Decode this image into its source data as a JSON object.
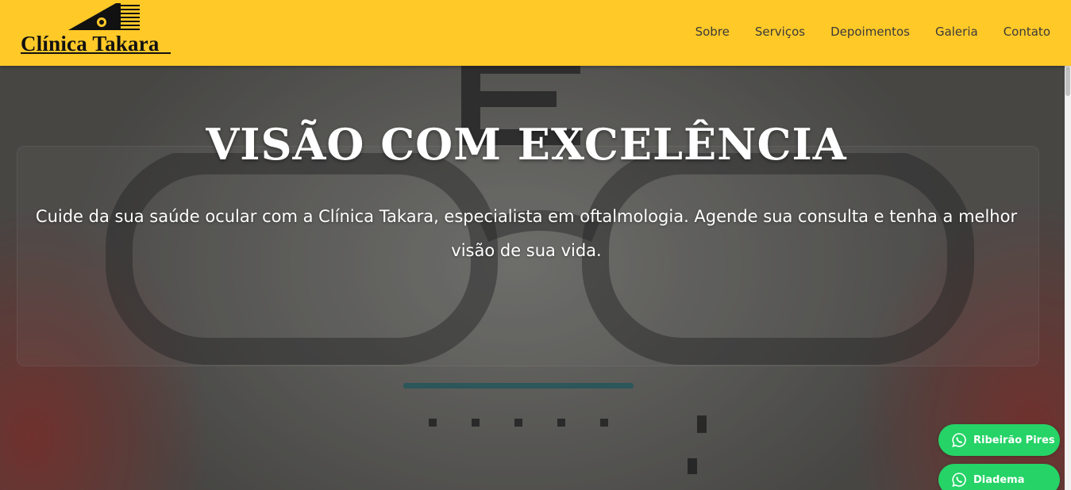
{
  "header": {
    "logo_text": "Clínica Takara",
    "nav": [
      "Sobre",
      "Serviços",
      "Depoimentos",
      "Galeria",
      "Contato"
    ]
  },
  "hero": {
    "title": "VISÃO COM EXCELÊNCIA",
    "subtitle": "Cuide da sua saúde ocular com a Clínica Takara, especialista em oftalmologia. Agende sua consulta e tenha a melhor visão de sua vida."
  },
  "whatsapp": {
    "buttons": [
      "Ribeirão Pires",
      "Diadema"
    ]
  },
  "colors": {
    "header_bg": "#ffc928",
    "whatsapp_green": "#25d366",
    "text_white": "#ffffff"
  },
  "icons": [
    "clinic-logo-icon",
    "whatsapp-icon"
  ]
}
